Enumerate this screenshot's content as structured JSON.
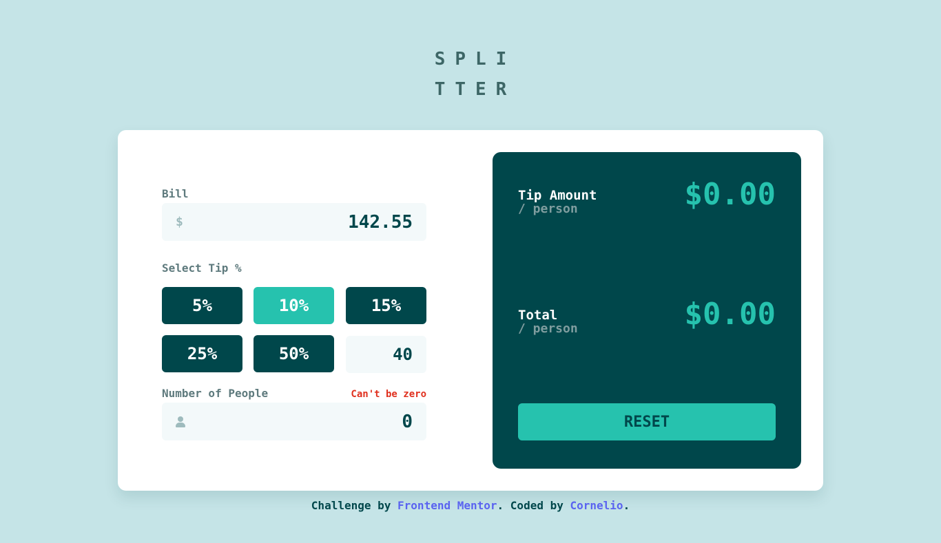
{
  "logo": {
    "line1": "SPLI",
    "line2": "TTER"
  },
  "bill": {
    "label": "Bill",
    "currency_symbol": "$",
    "value": "142.55"
  },
  "tip": {
    "label": "Select Tip %",
    "options": [
      "5%",
      "10%",
      "15%",
      "25%",
      "50%"
    ],
    "selected": "10%",
    "custom_value": "40"
  },
  "people": {
    "label": "Number of People",
    "error": "Can't be zero",
    "value": "0",
    "icon": "person-icon"
  },
  "results": {
    "tip_title": "Tip Amount",
    "tip_sub": "/ person",
    "tip_value": "$0.00",
    "total_title": "Total",
    "total_sub": "/ person",
    "total_value": "$0.00",
    "reset_label": "RESET"
  },
  "footer": {
    "text1": "Challenge by ",
    "link1": "Frontend Mentor",
    "text2": ". Coded by ",
    "link2": "Cornelio",
    "text3": "."
  },
  "colors": {
    "background": "#c5e4e7",
    "dark": "#00474b",
    "accent": "#26c2ae",
    "error": "#e0301e",
    "link": "#5a63f0"
  }
}
